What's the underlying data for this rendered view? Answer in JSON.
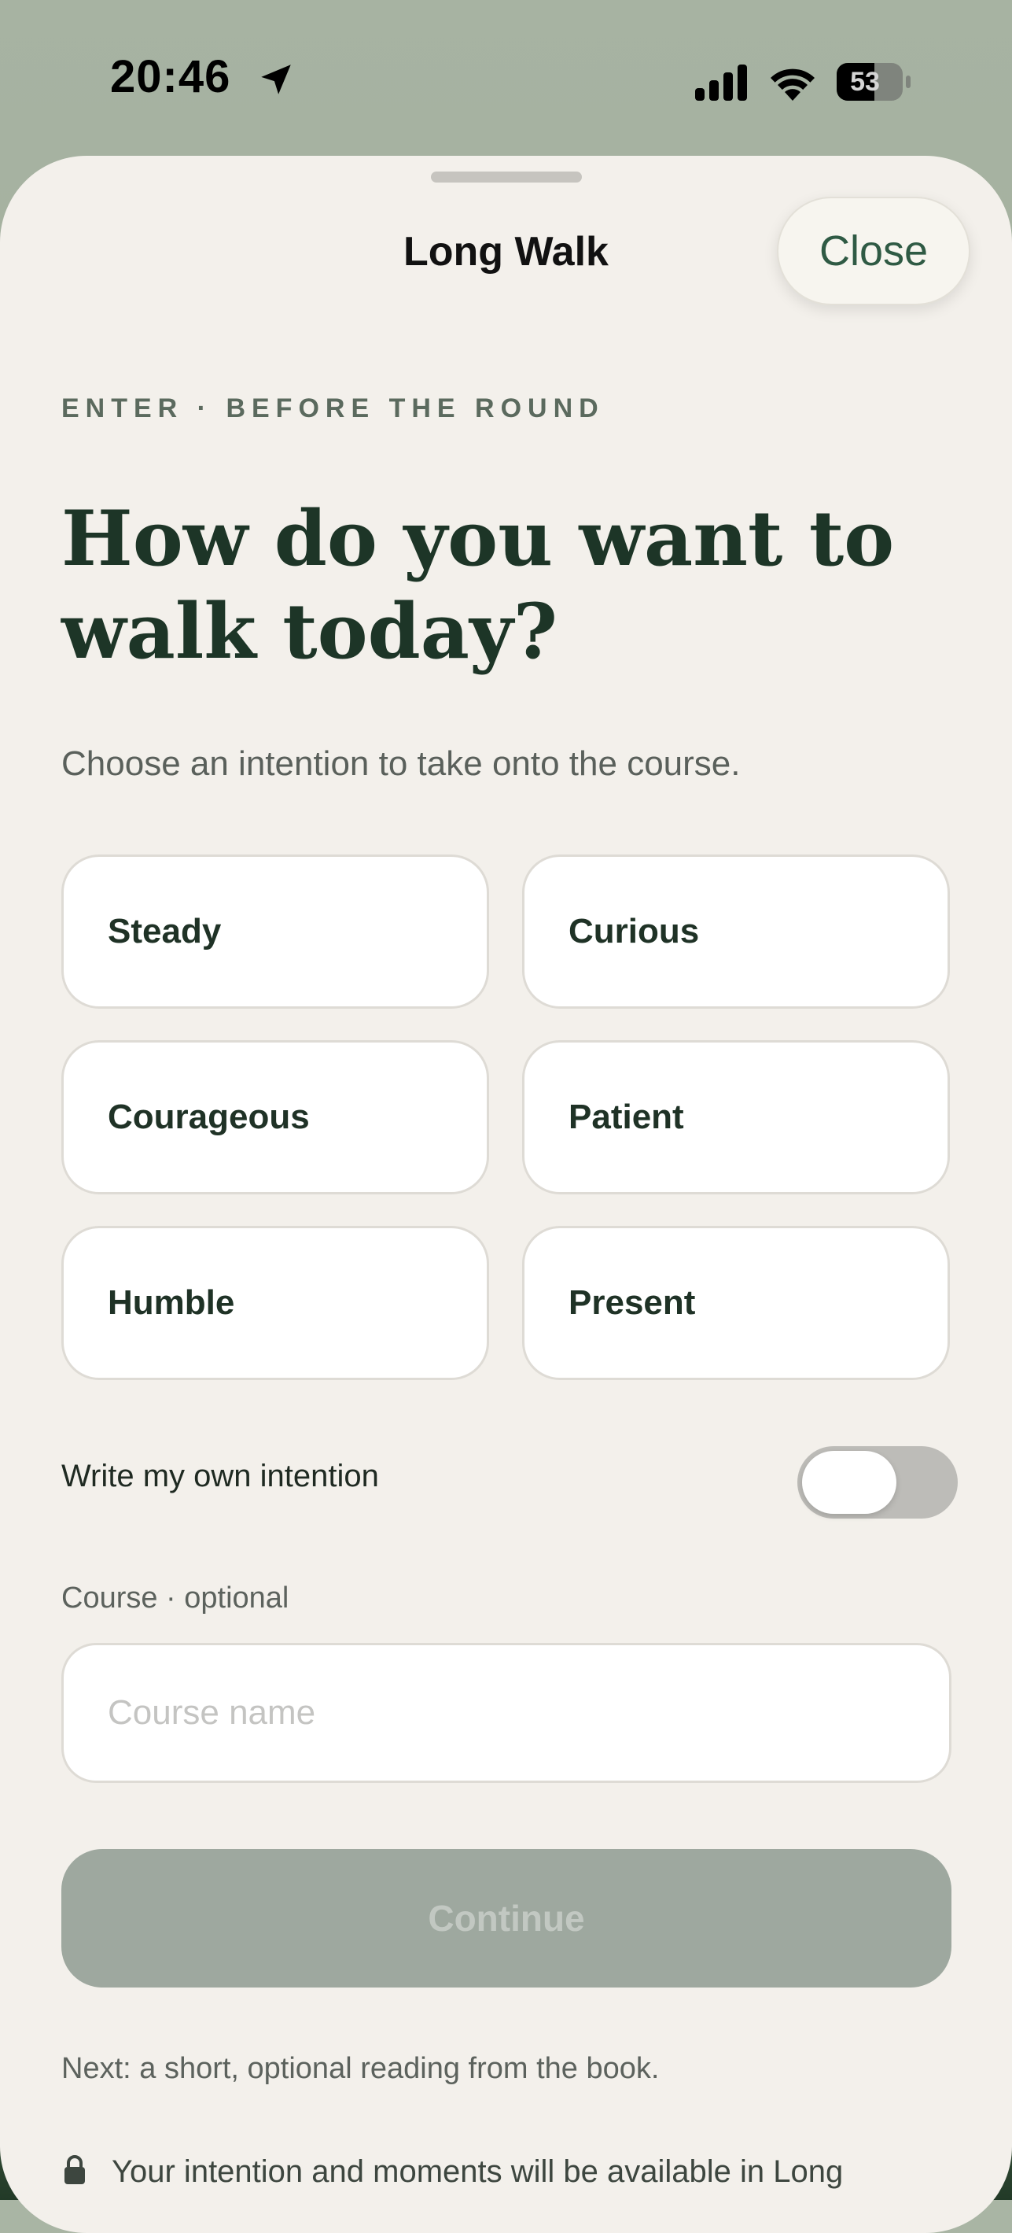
{
  "status_bar": {
    "time": "20:46",
    "battery": "53",
    "icons": [
      "location-arrow-icon",
      "cellular-signal-icon",
      "wifi-icon",
      "battery-icon"
    ]
  },
  "sheet": {
    "title": "Long Walk",
    "close_label": "Close"
  },
  "content": {
    "eyebrow": "ENTER · BEFORE THE ROUND",
    "headline_line1": "How do you want to",
    "headline_line2": "walk today?",
    "subtitle": "Choose an intention to take onto the course.",
    "intentions": [
      "Steady",
      "Curious",
      "Courageous",
      "Patient",
      "Humble",
      "Present"
    ],
    "own_intention_label": "Write my own intention",
    "own_intention_enabled": false,
    "course_label": "Course · optional",
    "course_placeholder": "Course name",
    "course_value": "",
    "continue_label": "Continue",
    "next_note": "Next: a short, optional reading from the book.",
    "footer_note": "Your intention and moments will be available in Long"
  },
  "colors": {
    "accent": "#2f5a44",
    "headline": "#1d3527",
    "sheet_background": "#f3f0eb",
    "continue_disabled": "#9ea89f"
  }
}
